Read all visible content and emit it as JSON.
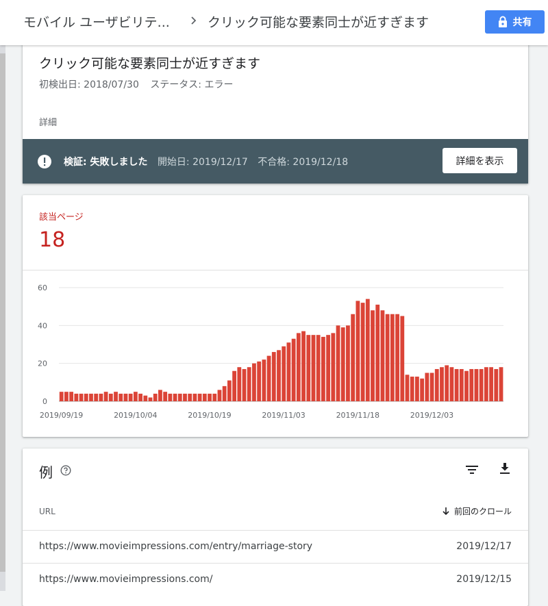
{
  "header": {
    "breadcrumb_parent": "モバイル ユーザビリテ...",
    "breadcrumb_current": "クリック可能な要素同士が近すぎます",
    "share_label": "共有"
  },
  "issue": {
    "title": "クリック可能な要素同士が近すぎます",
    "first_detected": "初検出日: 2018/07/30",
    "status": "ステータス: エラー",
    "details_label": "詳細",
    "validation_status": "検証: 失敗しました",
    "validation_started": "開始日: 2019/12/17",
    "validation_failed": "不合格: 2019/12/18",
    "details_button": "詳細を表示"
  },
  "affected": {
    "label": "該当ページ",
    "count": "18"
  },
  "colors": {
    "bar": "#db4437",
    "accent_red": "#c5221f",
    "validation_bar": "#455a64",
    "share_button": "#4285f4"
  },
  "chart_data": {
    "type": "bar",
    "ylim": [
      0,
      60
    ],
    "y_ticks": [
      "60",
      "40",
      "20",
      "0"
    ],
    "y_tick_values": [
      60,
      40,
      20,
      0
    ],
    "x_tick_labels": [
      {
        "label": "2019/09/19",
        "index": 0
      },
      {
        "label": "2019/10/04",
        "index": 15
      },
      {
        "label": "2019/10/19",
        "index": 30
      },
      {
        "label": "2019/11/03",
        "index": 45
      },
      {
        "label": "2019/11/18",
        "index": 60
      },
      {
        "label": "2019/12/03",
        "index": 75
      }
    ],
    "values": [
      5,
      5,
      5,
      4,
      4,
      4,
      4,
      4,
      4,
      5,
      4,
      5,
      4,
      4,
      4,
      5,
      4,
      3,
      2,
      4,
      6,
      5,
      4,
      4,
      4,
      4,
      4,
      4,
      4,
      4,
      4,
      4,
      6,
      8,
      11,
      16,
      18,
      17,
      18,
      20,
      21,
      22,
      24,
      26,
      27,
      29,
      31,
      33,
      36,
      37,
      35,
      35,
      35,
      34,
      35,
      36,
      40,
      39,
      40,
      46,
      53,
      52,
      54,
      48,
      51,
      48,
      46,
      46,
      46,
      45,
      14,
      13,
      13,
      12,
      15,
      15,
      17,
      18,
      19,
      18,
      17,
      17,
      16,
      17,
      17,
      17,
      18,
      18,
      17,
      18
    ]
  },
  "examples": {
    "title": "例",
    "col_url": "URL",
    "col_last_crawl": "前回のクロール",
    "rows": [
      {
        "url": "https://www.movieimpressions.com/entry/marriage-story",
        "date": "2019/12/17"
      },
      {
        "url": "https://www.movieimpressions.com/",
        "date": "2019/12/15"
      }
    ]
  }
}
